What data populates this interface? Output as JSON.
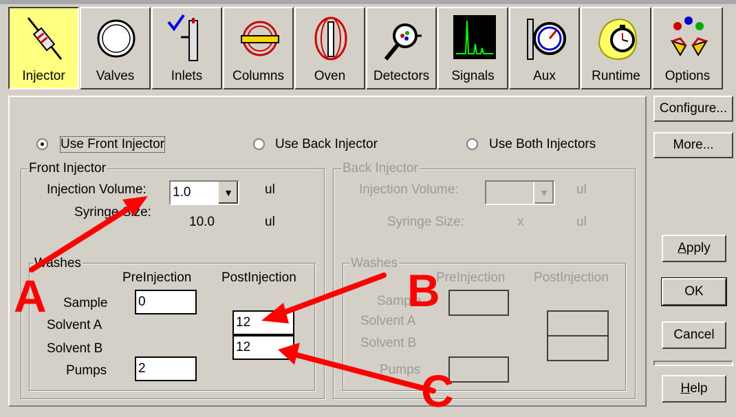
{
  "toolbar": {
    "items": [
      {
        "label": "Injector",
        "icon": "syringe-icon"
      },
      {
        "label": "Valves",
        "icon": "valve-icon"
      },
      {
        "label": "Inlets",
        "icon": "inlet-icon"
      },
      {
        "label": "Columns",
        "icon": "column-icon"
      },
      {
        "label": "Oven",
        "icon": "oven-icon"
      },
      {
        "label": "Detectors",
        "icon": "detector-icon"
      },
      {
        "label": "Signals",
        "icon": "signal-icon"
      },
      {
        "label": "Aux",
        "icon": "gauge-icon"
      },
      {
        "label": "Runtime",
        "icon": "stopwatch-icon"
      },
      {
        "label": "Options",
        "icon": "options-icon"
      }
    ],
    "active": "Injector"
  },
  "radios": {
    "front": "Use Front Injector",
    "back": "Use Back Injector",
    "both": "Use Both Injectors",
    "selected": "front"
  },
  "front": {
    "title": "Front Injector",
    "inj_label": "Injection Volume:",
    "inj_value": "1.0",
    "inj_unit": "ul",
    "syringe_label": "Syringe Size:",
    "syringe_value": "10.0",
    "syringe_unit": "ul",
    "washes": {
      "title": "Washes",
      "pre_header": "PreInjection",
      "post_header": "PostInjection",
      "sample_label": "Sample",
      "solvent_a_label": "Solvent A",
      "solvent_b_label": "Solvent B",
      "pumps_label": "Pumps",
      "sample_pre": "0",
      "solvent_a_post": "12",
      "solvent_b_post": "12",
      "pumps_pre": "2"
    }
  },
  "back": {
    "title": "Back Injector",
    "inj_label": "Injection Volume:",
    "inj_unit": "ul",
    "syringe_label": "Syringe Size:",
    "syringe_value": "x",
    "syringe_unit": "ul",
    "washes": {
      "title": "Washes",
      "pre_header": "PreInjection",
      "post_header": "PostInjection",
      "sample_label": "Sample",
      "solvent_a_label": "Solvent A",
      "solvent_b_label": "Solvent B",
      "pumps_label": "Pumps"
    }
  },
  "side_buttons": {
    "configure": "Configure...",
    "more": "More...",
    "apply": "Apply",
    "ok": "OK",
    "cancel": "Cancel",
    "help": "Help"
  },
  "callouts": {
    "a": "A",
    "b": "B",
    "c": "C",
    "color": "#ff0000"
  },
  "colors": {
    "active_tab": "#ffff80",
    "panel": "#d4d0c8"
  }
}
